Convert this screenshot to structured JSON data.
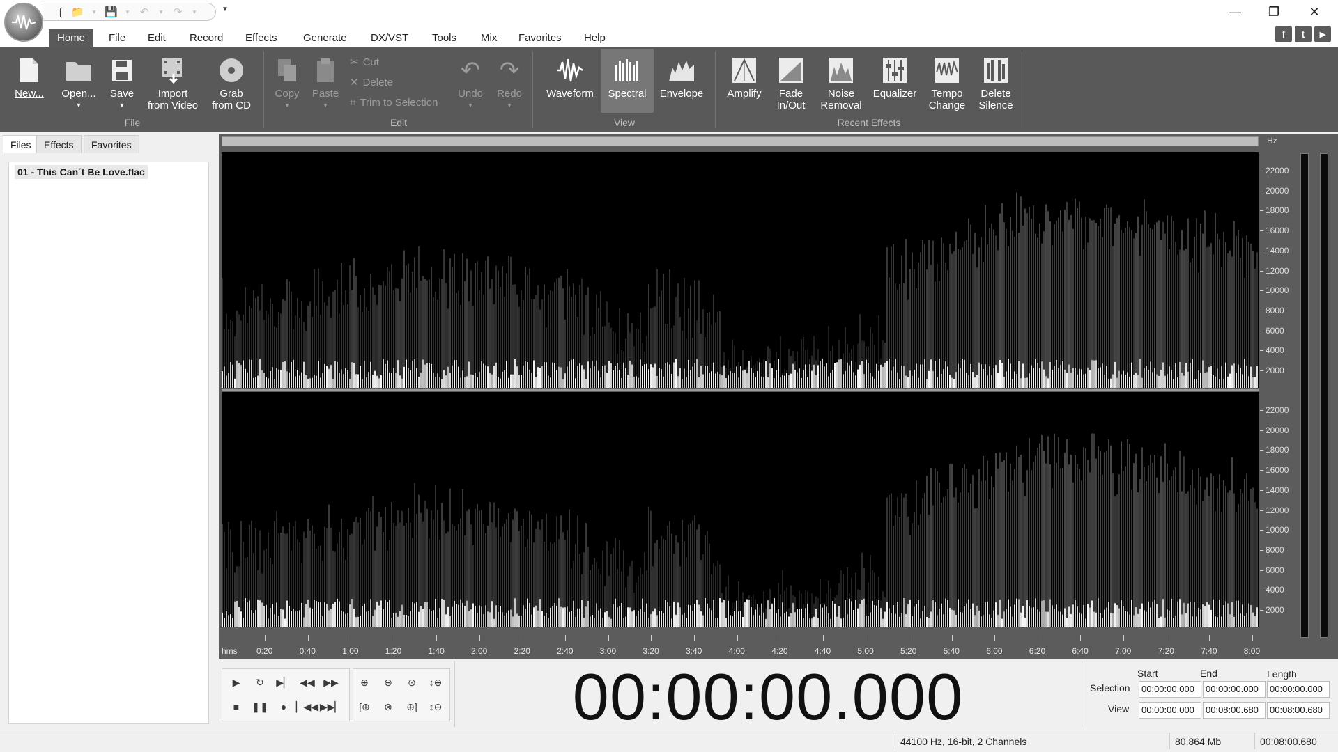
{
  "app": {
    "colors": {
      "ribbon_bg": "#595959",
      "spectrogram_bg": "#000000",
      "active_tab_bg": "#5a5a5a"
    }
  },
  "quick_access": {
    "icons": [
      "cursor-icon",
      "open-folder-icon",
      "dropdown-icon",
      "save-icon",
      "dropdown-icon",
      "undo-icon",
      "dropdown-icon",
      "redo-icon",
      "dropdown-icon",
      "customize-icon"
    ]
  },
  "window_controls": {
    "minimize": "—",
    "restore": "❐",
    "close": "✕"
  },
  "menu": {
    "tabs": [
      "Home",
      "File",
      "Edit",
      "Record",
      "Effects",
      "Generate",
      "DX/VST",
      "Tools",
      "Mix",
      "Favorites",
      "Help"
    ],
    "active": "Home"
  },
  "social": {
    "facebook": "f",
    "twitter": "t",
    "youtube": "▶"
  },
  "ribbon": {
    "file": {
      "label": "File",
      "new": "New...",
      "open": "Open...",
      "save": "Save",
      "import_video": [
        "Import",
        "from Video"
      ],
      "grab_cd": [
        "Grab",
        "from CD"
      ]
    },
    "edit": {
      "label": "Edit",
      "copy": "Copy",
      "paste": "Paste",
      "cut": "Cut",
      "delete": "Delete",
      "trim": "Trim to Selection",
      "undo": "Undo",
      "redo": "Redo"
    },
    "view": {
      "label": "View",
      "waveform": "Waveform",
      "spectral": "Spectral",
      "envelope": "Envelope",
      "selected": "Spectral"
    },
    "recent_effects": {
      "label": "Recent Effects",
      "amplify": "Amplify",
      "fade": [
        "Fade",
        "In/Out"
      ],
      "noise": [
        "Noise",
        "Removal"
      ],
      "equalizer": "Equalizer",
      "tempo": [
        "Tempo",
        "Change"
      ],
      "delete_silence": [
        "Delete",
        "Silence"
      ]
    }
  },
  "left_panel": {
    "tabs": [
      "Files",
      "Effects",
      "Favorites"
    ],
    "active_tab": "Files",
    "files": [
      "01 - This Can´t Be Love.flac"
    ]
  },
  "editor": {
    "freq_unit": "Hz",
    "freq_ticks": [
      "22000",
      "20000",
      "18000",
      "16000",
      "14000",
      "12000",
      "10000",
      "8000",
      "6000",
      "4000",
      "2000"
    ],
    "timeline_unit": "hms",
    "timeline_ticks": [
      "0:20",
      "0:40",
      "1:00",
      "1:20",
      "1:40",
      "2:00",
      "2:20",
      "2:40",
      "3:00",
      "3:20",
      "3:40",
      "4:00",
      "4:20",
      "4:40",
      "5:00",
      "5:20",
      "5:40",
      "6:00",
      "6:20",
      "6:40",
      "7:00",
      "7:20",
      "7:40",
      "8:00"
    ]
  },
  "transport": {
    "current_time": "00:00:00.000"
  },
  "selection_panel": {
    "headers": {
      "start": "Start",
      "end": "End",
      "length": "Length"
    },
    "selection": {
      "label": "Selection",
      "start": "00:00:00.000",
      "end": "00:00:00.000",
      "length": "00:00:00.000"
    },
    "view": {
      "label": "View",
      "start": "00:00:00.000",
      "end": "00:08:00.680",
      "length": "00:08:00.680"
    }
  },
  "status": {
    "format": "44100 Hz, 16-bit, 2 Channels",
    "size": "80.864 Mb",
    "duration": "00:08:00.680"
  }
}
